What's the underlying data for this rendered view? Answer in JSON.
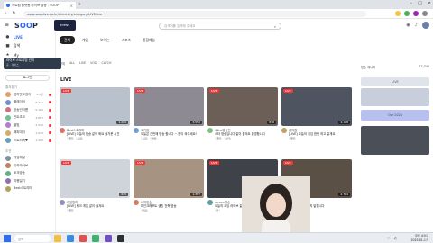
{
  "browser": {
    "tab_title": "스트림 플랫폼 라이브 방송 - SOOP",
    "new_tab": "+",
    "url": "www.sooplive.co.kr/directory/category/LIVE/live"
  },
  "header": {
    "logo_main": "S",
    "logo_o": "OO",
    "logo_end": "P",
    "banner_text": "EVENT",
    "search_placeholder": "검색어를 입력해 주세요"
  },
  "sidebar": {
    "items": [
      {
        "icon": "●",
        "label": "LIVE",
        "active": true
      },
      {
        "icon": "■",
        "label": "탐색"
      },
      {
        "icon": "★",
        "label": "My"
      },
      {
        "icon": "◆",
        "label": "e스포츠"
      }
    ],
    "tooltip_title": "라이브 스트리밍 관리",
    "tooltip_sub": "홈 · 서비스",
    "login_label": "로그인",
    "fav_header": "즐겨찾기",
    "favorites": [
      {
        "name": "감자맛오징어",
        "count": "1.2만",
        "color": "#e0a070"
      },
      {
        "name": "플레이어",
        "count": "8,341",
        "color": "#7090d0"
      },
      {
        "name": "방송인이름",
        "count": "5,102",
        "color": "#d07080"
      },
      {
        "name": "민트초코",
        "count": "3,887",
        "color": "#70c090"
      },
      {
        "name": "별빛",
        "count": "2,540",
        "color": "#b080d0"
      },
      {
        "name": "해피데이",
        "count": "1,930",
        "color": "#d0b060"
      },
      {
        "name": "스트리머♥",
        "count": "1,205",
        "color": "#60a0c0"
      }
    ],
    "rec_header": "추천",
    "recommended": [
      {
        "name": "게임채널",
        "color": "#8090a0"
      },
      {
        "name": "뮤직라이브",
        "color": "#c08060"
      },
      {
        "name": "토크방송",
        "color": "#60b080"
      },
      {
        "name": "여행일기",
        "color": "#9070b0"
      },
      {
        "name": "Best스트리머",
        "color": "#b0a060"
      }
    ]
  },
  "main": {
    "categories": [
      "전체",
      "게임",
      "보이는",
      "스포츠",
      "종합예능"
    ],
    "sub_tabs": [
      "전체",
      "ALL",
      "LIVE",
      "VOD",
      "CATCH"
    ],
    "section_title": "LIVE",
    "live_badge": "LIVE",
    "row1": [
      {
        "streamer": "Best스트리머",
        "title": "[LIVE] 오늘의 방송 같이 봐요 즐거운 시간",
        "viewers": "1,204",
        "tags": [
          "게임",
          "토크"
        ],
        "bg": "#b9c1cc",
        "av": "#e07070"
      },
      {
        "streamer": "고기쌈",
        "title": "오늘은 간만에 방송 합니다 ~ 많이 와주세요!",
        "viewers": "3,552",
        "tags": [
          "토크",
          "먹방"
        ],
        "bg": "#8d8a93",
        "av": "#70a0d0"
      },
      {
        "streamer": "4Bne방송인",
        "title": "스타 방송입니다 같이 즐겨요 환영합니다",
        "viewers": "876",
        "tags": [
          "게임",
          "스타"
        ],
        "bg": "#6b5f58",
        "av": "#80c080"
      },
      {
        "streamer": "감자칩",
        "title": "[LIVE] 오늘의 게임 한판 하고 갈게요",
        "viewers": "2,118",
        "tags": [
          "게임"
        ],
        "bg": "#4f5560",
        "av": "#c0a060"
      }
    ],
    "row2": [
      {
        "streamer": "게임왕자",
        "title": "[LIVE] 랭크 게임 같이 즐겨요",
        "viewers": "645",
        "tags": [
          "게임"
        ],
        "bg": "#cfd4da",
        "av": "#9090c0"
      },
      {
        "streamer": "너의방송",
        "title": "마인크래프트 생존 건축 방송",
        "viewers": "1,387",
        "tags": [
          "마크"
        ],
        "bg": "#a69381",
        "av": "#d08060"
      },
      {
        "streamer": "screen방송",
        "title": "오늘의 코딩 라이브 같이해요",
        "viewers": "932",
        "tags": [
          "IT"
        ],
        "bg": "#3f4248",
        "av": "#60a0a0"
      },
      {
        "streamer": "플레이",
        "title": "액션 게임 엔딩까지 달립니다",
        "viewers": "2,764",
        "tags": [
          "게임"
        ],
        "bg": "#5a5046",
        "av": "#b070a0"
      }
    ]
  },
  "rightcol": {
    "top_label": "방송 매니저",
    "top_value": "12,345",
    "side_label": "LIVE",
    "purple_label": "Owl 2024"
  },
  "taskbar": {
    "search": "검색",
    "time": "오후 4:51",
    "date": "2025-01-17"
  }
}
